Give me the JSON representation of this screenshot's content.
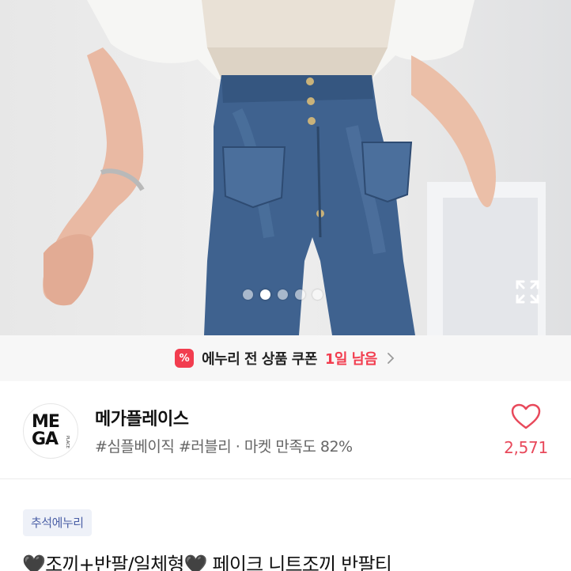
{
  "gallery": {
    "total_images": 5,
    "active_index": 1
  },
  "coupon": {
    "icon": "percent-coupon-icon",
    "icon_glyph": "%",
    "text": "에누리 전 상품 쿠폰",
    "highlight": "1일 남음",
    "accent_color": "#f23d4f"
  },
  "shop": {
    "logo_line1": "ME",
    "logo_line2": "GA",
    "logo_small": "PLACE",
    "name": "메가플레이스",
    "hashtags": "#심플베이직 #러블리",
    "separator": "·",
    "satisfaction": "마켓 만족도 82%",
    "like_count": "2,571",
    "like_color": "#e8495b"
  },
  "product": {
    "tag": "추석에누리",
    "title": "🖤조끼+반팔/일체형🖤 페이크 니트조끼 반팔티"
  }
}
